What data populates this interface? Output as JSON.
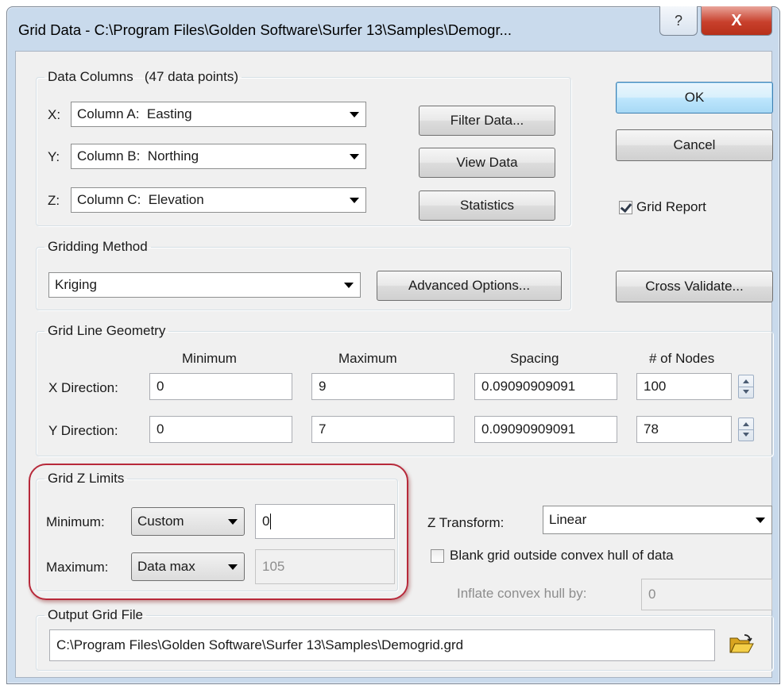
{
  "window": {
    "title": "Grid Data - C:\\Program Files\\Golden Software\\Surfer 13\\Samples\\Demogr...",
    "help_icon": "?",
    "close_icon": "X"
  },
  "data_columns": {
    "legend": "Data Columns   (47 data points)",
    "x_label": "X:",
    "y_label": "Y:",
    "z_label": "Z:",
    "x_value": "Column A:  Easting",
    "y_value": "Column B:  Northing",
    "z_value": "Column C:  Elevation",
    "filter_button": "Filter Data...",
    "view_button": "View Data",
    "stats_button": "Statistics"
  },
  "actions": {
    "ok": "OK",
    "cancel": "Cancel",
    "grid_report": "Grid Report",
    "grid_report_checked": true,
    "cross_validate": "Cross Validate..."
  },
  "gridding_method": {
    "legend": "Gridding Method",
    "value": "Kriging",
    "advanced_button": "Advanced Options..."
  },
  "geometry": {
    "legend": "Grid Line Geometry",
    "headers": [
      "Minimum",
      "Maximum",
      "Spacing",
      "# of Nodes"
    ],
    "x_label": "X Direction:",
    "y_label": "Y Direction:",
    "x": {
      "min": "0",
      "max": "9",
      "spacing": "0.09090909091",
      "nodes": "100"
    },
    "y": {
      "min": "0",
      "max": "7",
      "spacing": "0.09090909091",
      "nodes": "78"
    }
  },
  "z_limits": {
    "legend": "Grid Z Limits",
    "min_label": "Minimum:",
    "max_label": "Maximum:",
    "min_mode": "Custom",
    "max_mode": "Data max",
    "min_value": "0",
    "max_value": "105"
  },
  "z_transform": {
    "label": "Z Transform:",
    "value": "Linear"
  },
  "blank": {
    "label": "Blank grid outside convex hull of data",
    "checked": false,
    "inflate_label": "Inflate convex hull by:",
    "inflate_value": "0"
  },
  "output": {
    "legend": "Output Grid File",
    "path": "C:\\Program Files\\Golden Software\\Surfer 13\\Samples\\Demogrid.grd",
    "browse_icon": "folder-open-icon"
  },
  "colors": {
    "highlight": "#b7293a",
    "frame": "#c9daec",
    "close": "#c8402c"
  }
}
